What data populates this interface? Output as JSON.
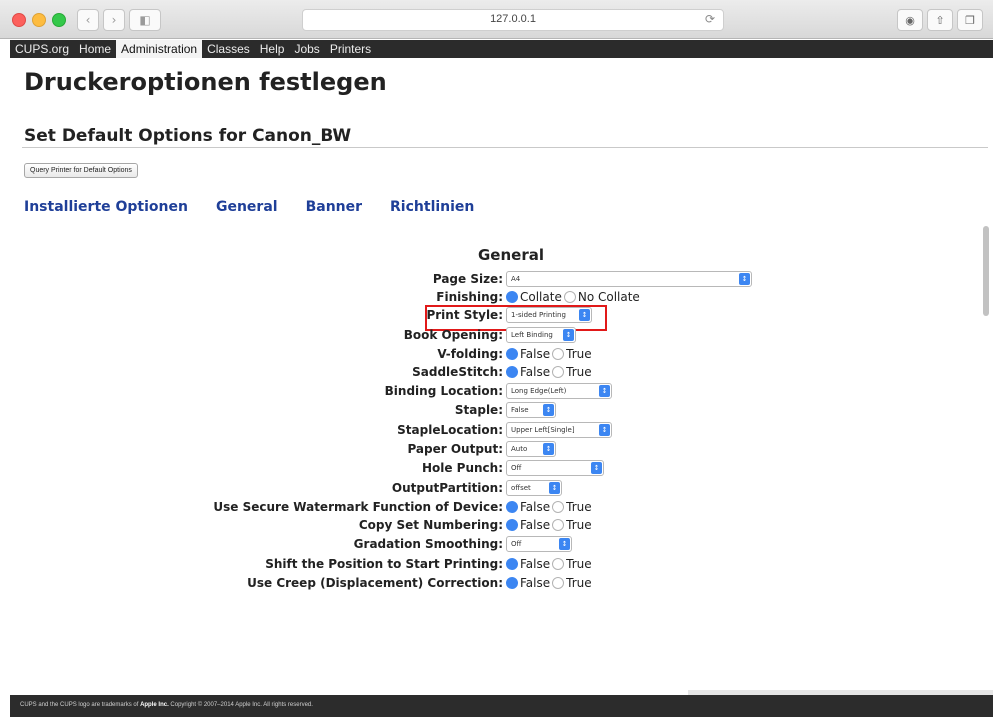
{
  "browser": {
    "url": "127.0.0.1",
    "reload_icon": "reload-icon",
    "share_icon": "share-icon",
    "tabs_icon": "tabs-icon",
    "download_icon": "downloads-icon"
  },
  "nav": {
    "items": [
      "CUPS.org",
      "Home",
      "Administration",
      "Classes",
      "Help",
      "Jobs",
      "Printers"
    ],
    "active": "Administration"
  },
  "page": {
    "title": "Druckeroptionen festlegen",
    "subtitle": "Set Default Options for Canon_BW",
    "query_button": "Query Printer for Default Options",
    "tabs": [
      "Installierte Optionen",
      "General",
      "Banner",
      "Richtlinien"
    ]
  },
  "form": {
    "section_title": "General",
    "rows": [
      {
        "label": "Page Size:",
        "type": "select",
        "value": "A4"
      },
      {
        "label": "Finishing:",
        "type": "radio",
        "options": [
          "Collate",
          "No Collate"
        ],
        "selected": 0
      },
      {
        "label": "Print Style:",
        "type": "select",
        "value": "1-sided Printing",
        "highlighted": true
      },
      {
        "label": "Book Opening:",
        "type": "select",
        "value": "Left Binding"
      },
      {
        "label": "V-folding:",
        "type": "radio",
        "options": [
          "False",
          "True"
        ],
        "selected": 0
      },
      {
        "label": "SaddleStitch:",
        "type": "radio",
        "options": [
          "False",
          "True"
        ],
        "selected": 0
      },
      {
        "label": "Binding Location:",
        "type": "select",
        "value": "Long Edge(Left)"
      },
      {
        "label": "Staple:",
        "type": "select",
        "value": "False"
      },
      {
        "label": "StapleLocation:",
        "type": "select",
        "value": "Upper Left[Single]"
      },
      {
        "label": "Paper Output:",
        "type": "select",
        "value": "Auto"
      },
      {
        "label": "Hole Punch:",
        "type": "select",
        "value": "Off"
      },
      {
        "label": "OutputPartition:",
        "type": "select",
        "value": "offset"
      },
      {
        "label": "Use Secure Watermark Function of Device:",
        "type": "radio",
        "options": [
          "False",
          "True"
        ],
        "selected": 0
      },
      {
        "label": "Copy Set Numbering:",
        "type": "radio",
        "options": [
          "False",
          "True"
        ],
        "selected": 0
      },
      {
        "label": "Gradation Smoothing:",
        "type": "select",
        "value": "Off"
      },
      {
        "label": "Shift the Position to Start Printing:",
        "type": "radio",
        "options": [
          "False",
          "True"
        ],
        "selected": 0
      },
      {
        "label": "Use Creep (Displacement) Correction:",
        "type": "radio",
        "options": [
          "False",
          "True"
        ],
        "selected": 0
      }
    ]
  },
  "footer": {
    "text_prefix": "CUPS and the CUPS logo are trademarks of ",
    "brand": "Apple Inc.",
    "text_suffix": " Copyright © 2007–2014 Apple Inc. All rights reserved."
  },
  "colors": {
    "accent": "#3c86f2",
    "nav_bg": "#2b2b2b",
    "highlight": "#e11919",
    "tab_link": "#1f3f98"
  }
}
